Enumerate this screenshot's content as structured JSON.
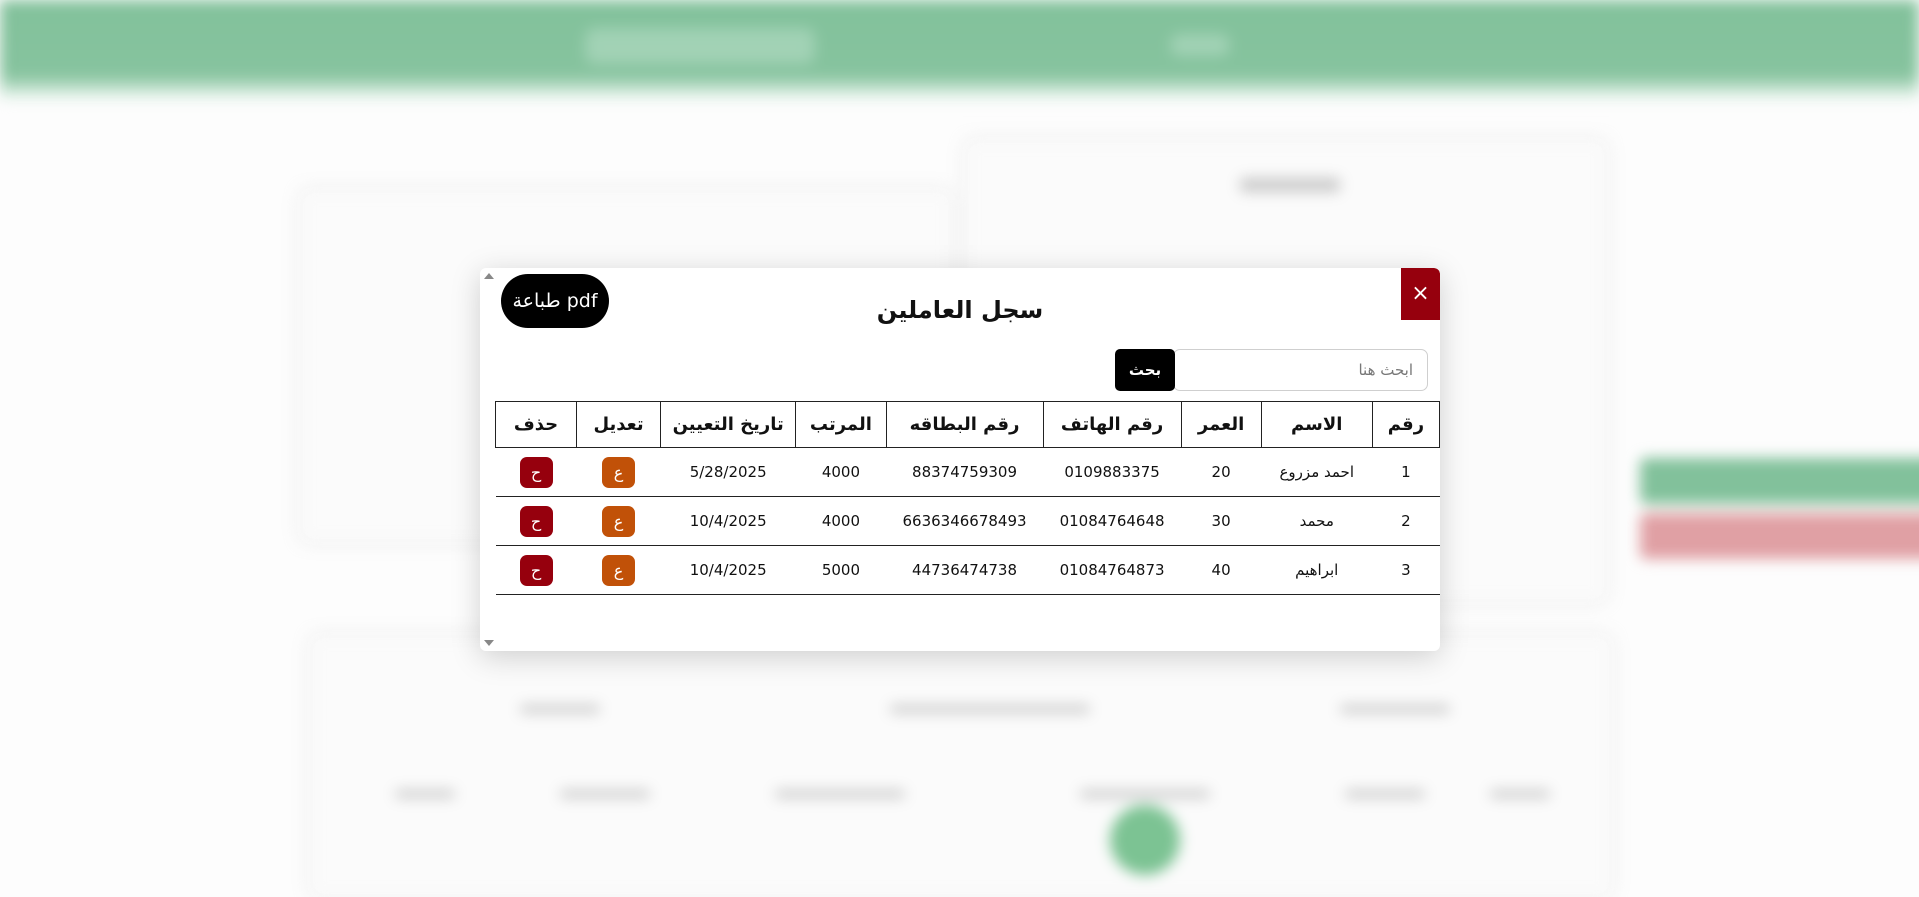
{
  "modal": {
    "title": "سجل العاملين",
    "close_label": "×",
    "pdf_label": "طباعة pdf",
    "search": {
      "placeholder": "ابحث هنا",
      "value": "",
      "button_label": "بحث"
    }
  },
  "table": {
    "headers": [
      "رقم",
      "الاسم",
      "العمر",
      "رقم الهاتف",
      "رقم البطاقه",
      "المرتب",
      "تاريخ التعيين",
      "تعديل",
      "حذف"
    ],
    "edit_label": "ع",
    "delete_label": "ح",
    "rows": [
      {
        "id": "1",
        "name": "احمد مزروع",
        "age": "20",
        "phone": "0109883375",
        "card": "88374759309",
        "salary": "4000",
        "hire_date": "5/28/2025"
      },
      {
        "id": "2",
        "name": "محمد",
        "age": "30",
        "phone": "01084764648",
        "card": "6636346678493",
        "salary": "4000",
        "hire_date": "10/4/2025"
      },
      {
        "id": "3",
        "name": "ابراهيم",
        "age": "40",
        "phone": "01084764873",
        "card": "44736474738",
        "salary": "5000",
        "hire_date": "10/4/2025"
      }
    ]
  },
  "colors": {
    "accent_green": "#82c19b",
    "danger": "#96000d",
    "edit": "#c15108",
    "primary_button": "#000000"
  }
}
